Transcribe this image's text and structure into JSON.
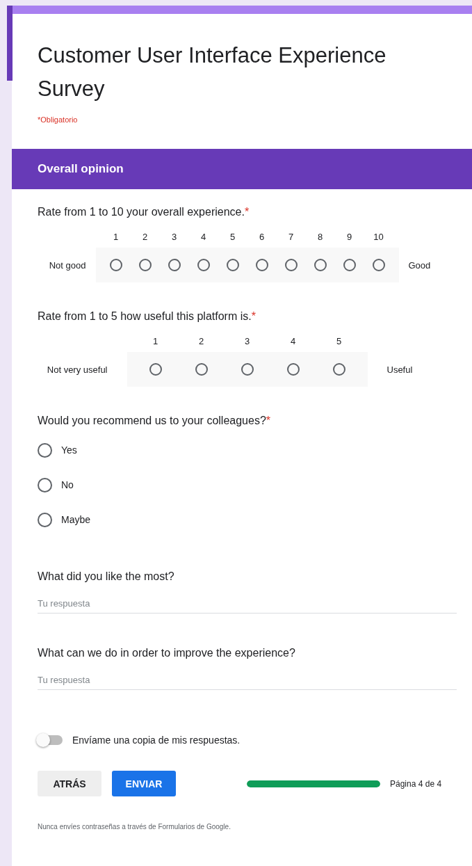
{
  "form": {
    "title": "Customer User Interface Experience Survey",
    "required_note": "*Obligatorio"
  },
  "section": {
    "title": "Overall opinion"
  },
  "questions": [
    {
      "kind": "scale",
      "title": "Rate from 1 to 10 your overall experience.",
      "required_mark": "*",
      "low_label": "Not good",
      "high_label": "Good",
      "options": [
        {
          "label": "1",
          "selected": false
        },
        {
          "label": "2",
          "selected": false
        },
        {
          "label": "3",
          "selected": false
        },
        {
          "label": "4",
          "selected": false
        },
        {
          "label": "5",
          "selected": false
        },
        {
          "label": "6",
          "selected": false
        },
        {
          "label": "7",
          "selected": false
        },
        {
          "label": "8",
          "selected": false
        },
        {
          "label": "9",
          "selected": false
        },
        {
          "label": "10",
          "selected": false
        }
      ]
    },
    {
      "kind": "scale",
      "title": "Rate from 1 to 5 how useful this platform is.",
      "required_mark": "*",
      "low_label": "Not very useful",
      "high_label": "Useful",
      "options": [
        {
          "label": "1",
          "selected": false
        },
        {
          "label": "2",
          "selected": false
        },
        {
          "label": "3",
          "selected": false
        },
        {
          "label": "4",
          "selected": false
        },
        {
          "label": "5",
          "selected": false
        }
      ]
    },
    {
      "kind": "choice",
      "title": "Would you recommend us to your colleagues?",
      "required_mark": "*",
      "options": [
        {
          "label": "Yes",
          "selected": false
        },
        {
          "label": "No",
          "selected": false
        },
        {
          "label": "Maybe",
          "selected": false
        }
      ]
    },
    {
      "kind": "text",
      "title": "What did you like the most?",
      "placeholder": "Tu respuesta"
    },
    {
      "kind": "text",
      "title": "What can we do in order to improve the experience?",
      "placeholder": "Tu respuesta"
    }
  ],
  "copy_toggle": {
    "label": "Envíame una copia de mis respuestas.",
    "on": false
  },
  "buttons": {
    "back": "ATRÁS",
    "submit": "ENVIAR"
  },
  "progress": {
    "level": 1,
    "label": "Página 4 de 4"
  },
  "footer_note": "Nunca envíes contraseñas a través de Formularios de Google."
}
